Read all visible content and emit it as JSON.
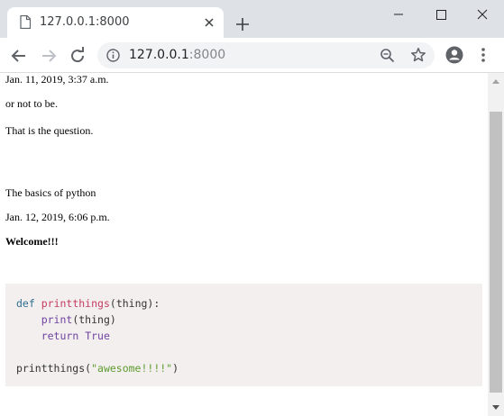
{
  "tab": {
    "title": "127.0.0.1:8000"
  },
  "address_bar": {
    "host": "127.0.0.1",
    "port": ":8000"
  },
  "posts": [
    {
      "date": "Jan. 11, 2019, 3:37 a.m.",
      "lines": [
        "or not to be.",
        "That is the question."
      ]
    },
    {
      "title": "The basics of python",
      "date": "Jan. 12, 2019, 6:06 p.m.",
      "heading": "Welcome!!!"
    }
  ],
  "code_block": {
    "line1": {
      "kw": "def",
      "fn": "printthings",
      "rest": "(thing):"
    },
    "line2": {
      "indent": "    ",
      "builtin": "print",
      "rest": "(thing)"
    },
    "line3": {
      "indent": "    ",
      "kw": "return",
      "sp": " ",
      "builtin": "True"
    },
    "line5": {
      "call": "printthings(",
      "str": "\"awesome!!!!\"",
      "close": ")"
    }
  },
  "icons": {
    "tab_favicon": "page-icon",
    "tab_close": "close-icon",
    "new_tab": "plus-icon",
    "back": "arrow-left-icon",
    "forward": "arrow-right-icon",
    "reload": "reload-icon",
    "info": "info-icon",
    "zoom": "zoom-out-icon",
    "bookmark": "star-icon",
    "account": "account-icon",
    "menu": "more-vert-icon"
  },
  "colors": {
    "tabstrip": "#dee1e6",
    "omnibox": "#f1f3f4",
    "code_bg": "#f3efef",
    "keyword": "#2e6f8e",
    "function": "#c53c60",
    "string": "#5e9c2f"
  }
}
